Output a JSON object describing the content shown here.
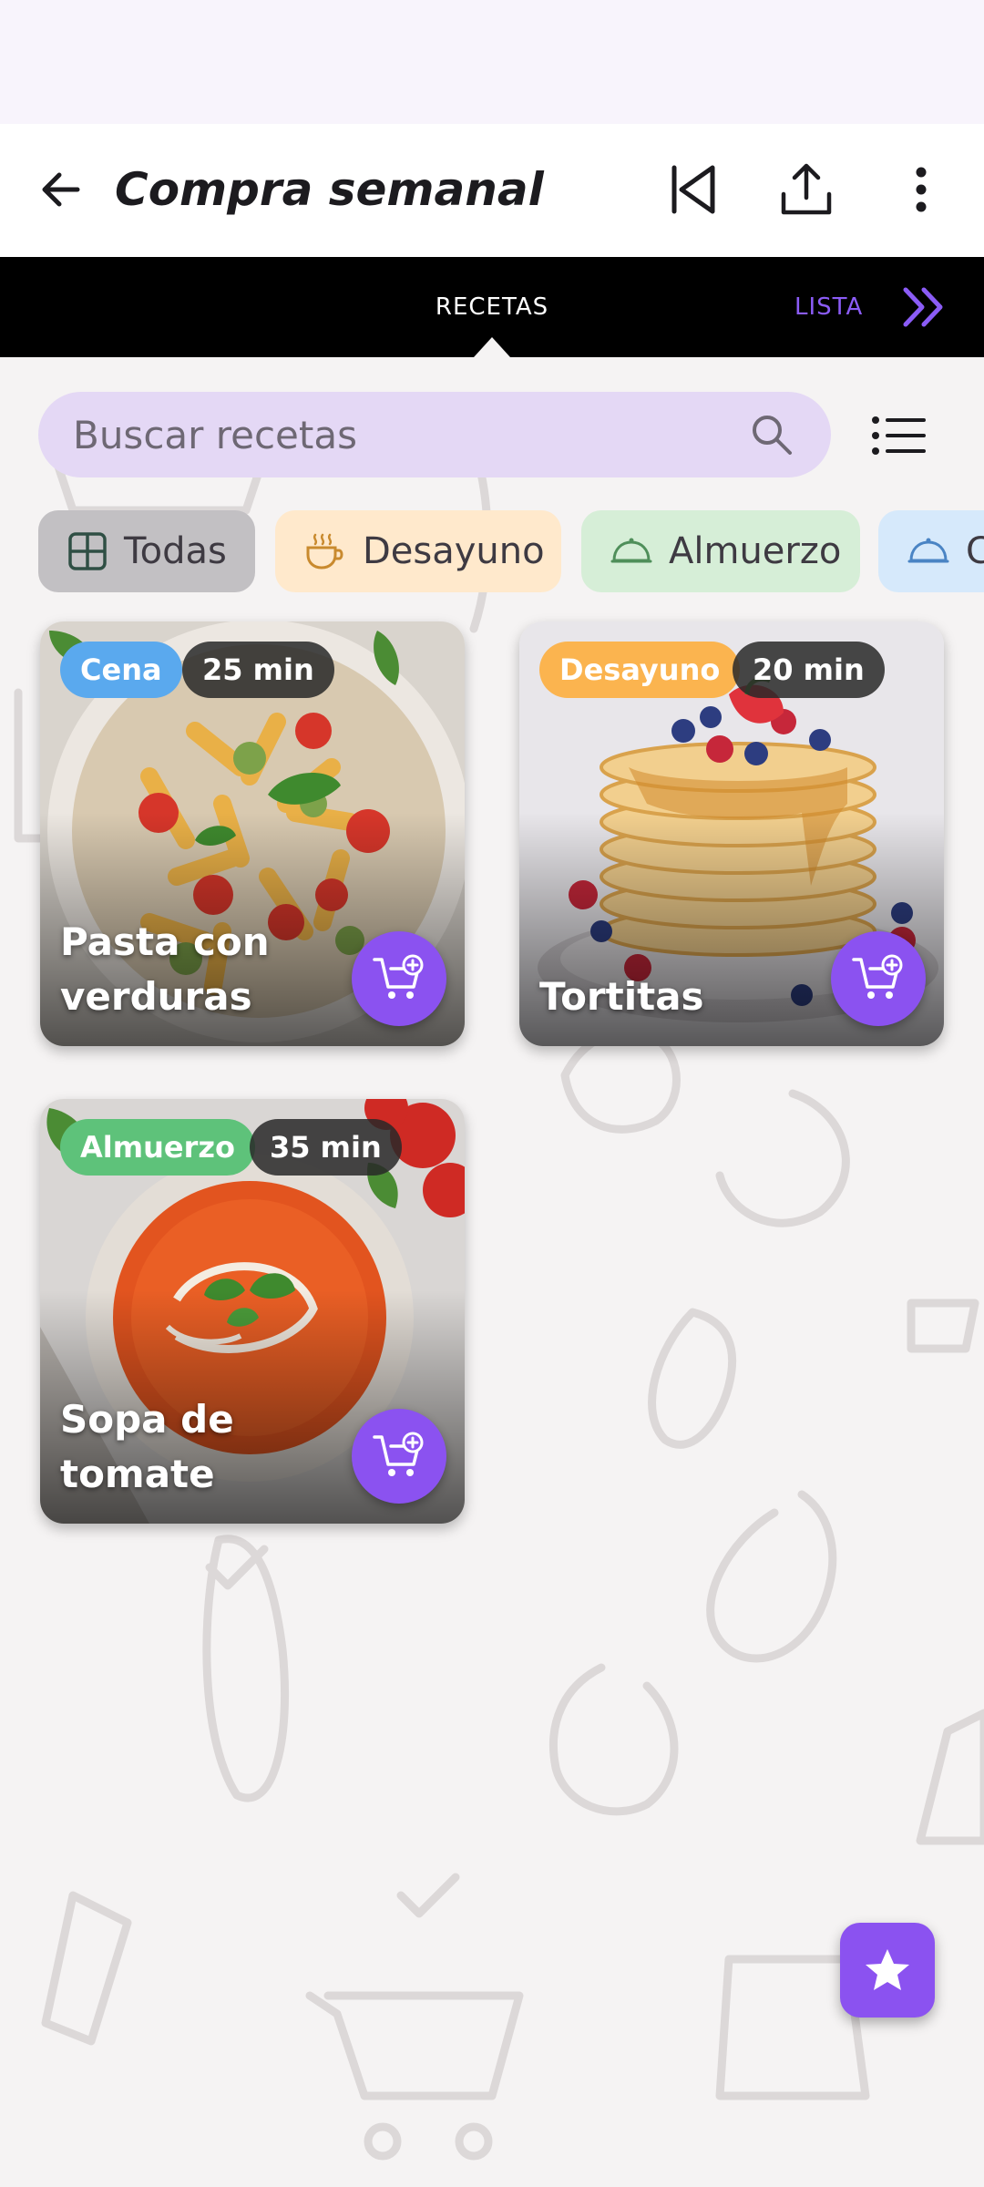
{
  "app_bar": {
    "title": "Compra semanal",
    "back_icon": "arrow-left-icon",
    "actions": [
      "skip-previous-icon",
      "share-upload-icon",
      "more-vertical-icon"
    ]
  },
  "tabs": {
    "active": "RECETAS",
    "next": "LISTA",
    "next_icon": "double-chevron-right-icon"
  },
  "search": {
    "placeholder": "Buscar recetas",
    "icon": "search-icon"
  },
  "filter_icon": "list-filter-icon",
  "chips": [
    {
      "label": "Todas",
      "icon": "grid-icon",
      "bg": "#c2c0c3",
      "selected": true
    },
    {
      "label": "Desayuno",
      "icon": "coffee-cup-icon",
      "bg": "#ffe9cc",
      "selected": false
    },
    {
      "label": "Almuerzo",
      "icon": "cloche-icon",
      "bg": "#d6eed7",
      "selected": false
    },
    {
      "label": "Cena",
      "icon": "cloche-icon",
      "bg": "#d6e9fb",
      "selected": false
    }
  ],
  "recipes": [
    {
      "name": "Pasta con verduras",
      "category": "Cena",
      "category_color": "#5aa9ee",
      "time": "25 min"
    },
    {
      "name": "Tortitas",
      "category": "Desayuno",
      "category_color": "#fbb44f",
      "time": "20 min"
    },
    {
      "name": "Sopa de tomate",
      "category": "Almuerzo",
      "category_color": "#5ec27a",
      "time": "35 min"
    }
  ],
  "fab_icon": "star-icon",
  "colors": {
    "accent": "#8b52f0",
    "tab_bar": "#000000",
    "background": "#f5f3f3"
  }
}
